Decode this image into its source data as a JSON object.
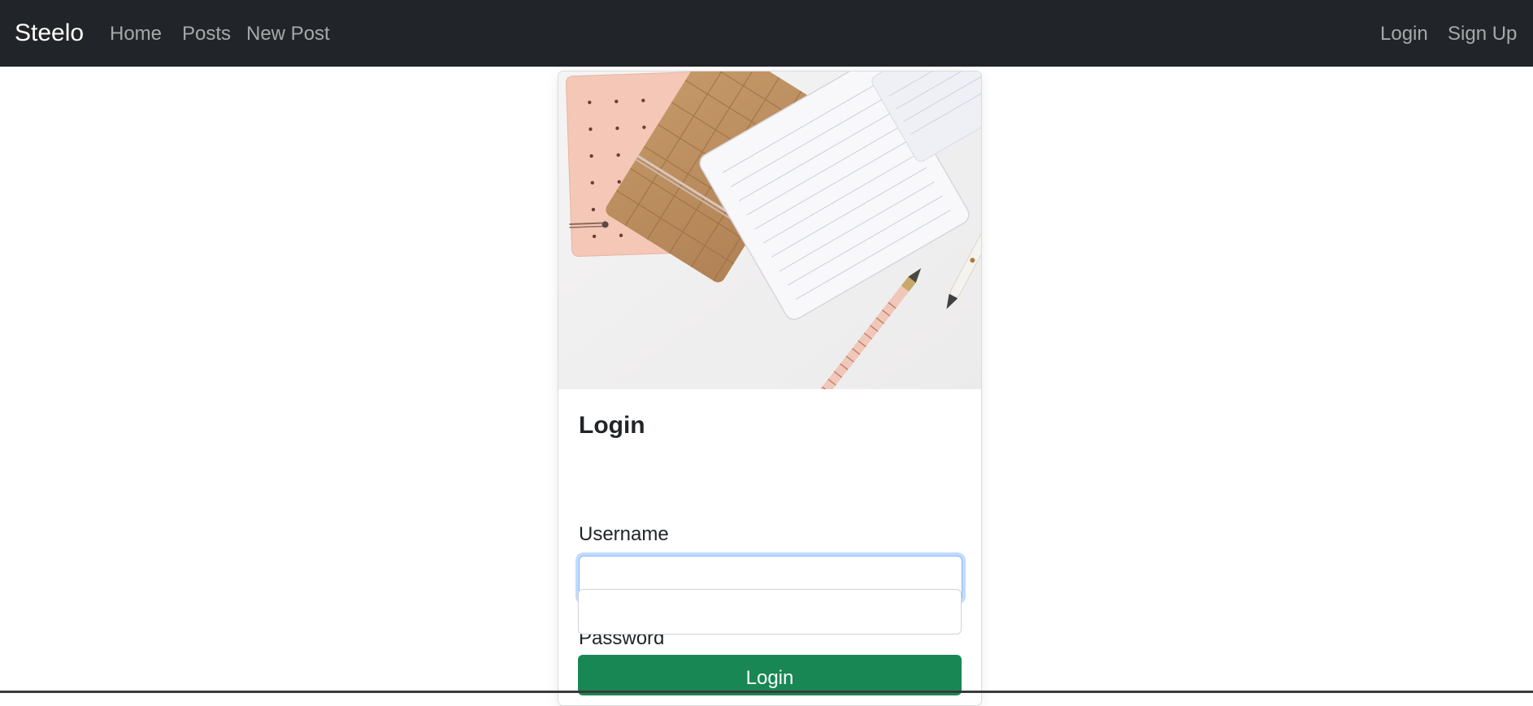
{
  "navbar": {
    "brand": "Steelo",
    "left_links": [
      {
        "label": "Home"
      },
      {
        "label": "Posts"
      },
      {
        "label": "New Post"
      }
    ],
    "right_links": [
      {
        "label": "Login"
      },
      {
        "label": "Sign Up"
      }
    ]
  },
  "login_card": {
    "image_alt": "Notebooks and pens on a white desk",
    "title": "Login",
    "username": {
      "label": "Username",
      "value": "",
      "placeholder": ""
    },
    "password": {
      "label": "Password",
      "value": "",
      "placeholder": ""
    },
    "submit_label": "Login"
  },
  "colors": {
    "navbar_bg": "#212529",
    "accent_green": "#198754",
    "focus_blue": "#86b7fe"
  }
}
